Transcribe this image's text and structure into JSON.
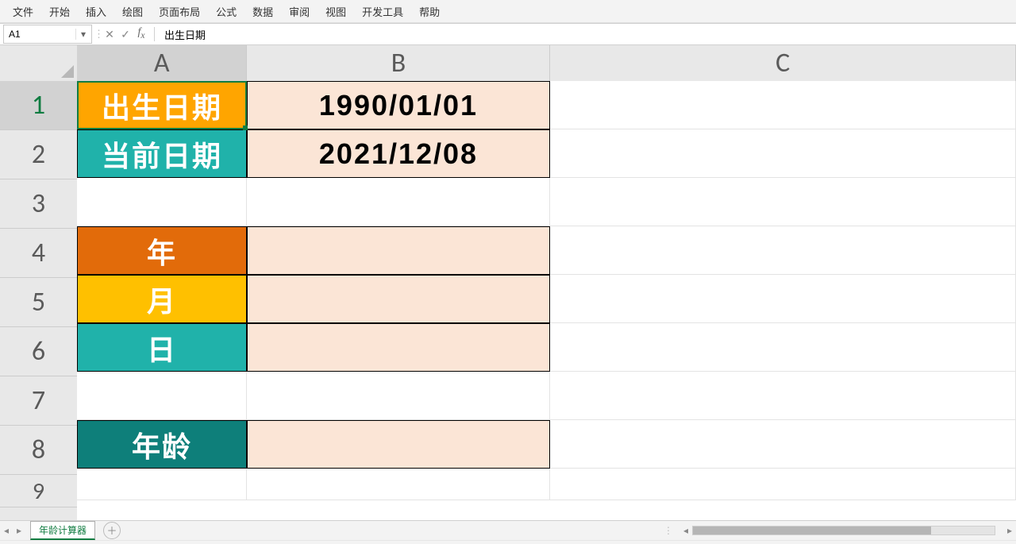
{
  "menu": {
    "items": [
      "文件",
      "开始",
      "插入",
      "绘图",
      "页面布局",
      "公式",
      "数据",
      "审阅",
      "视图",
      "开发工具",
      "帮助"
    ]
  },
  "namebox": {
    "value": "A1"
  },
  "formula": {
    "value": "出生日期"
  },
  "columns": [
    "A",
    "B",
    "C"
  ],
  "rows": [
    "1",
    "2",
    "3",
    "4",
    "5",
    "6",
    "7",
    "8",
    "9"
  ],
  "cells": {
    "A1": "出生日期",
    "B1": "1990/01/01",
    "A2": "当前日期",
    "B2": "2021/12/08",
    "A4": "年",
    "A5": "月",
    "A6": "日",
    "A8": "年龄"
  },
  "sheet": {
    "tab": "年龄计算器"
  },
  "chart_data": {
    "type": "table",
    "title": "年龄计算器",
    "labels": {
      "birth_date": "出生日期",
      "current_date": "当前日期",
      "years": "年",
      "months": "月",
      "days": "日",
      "age": "年龄"
    },
    "values": {
      "birth_date": "1990/01/01",
      "current_date": "2021/12/08",
      "years": null,
      "months": null,
      "days": null,
      "age": null
    }
  }
}
